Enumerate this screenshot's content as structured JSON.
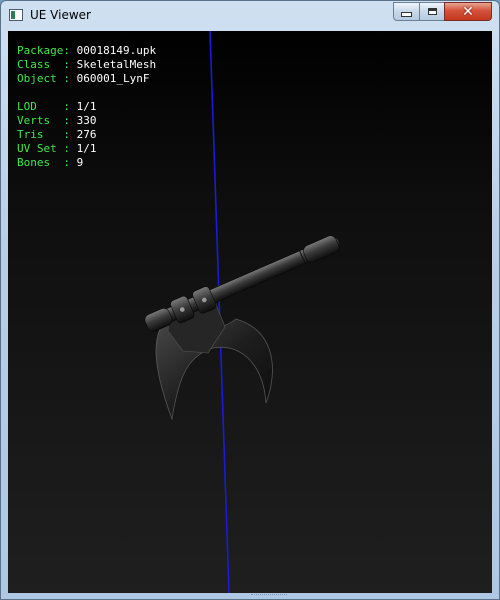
{
  "window": {
    "title": "UE Viewer",
    "icon": "app-window-icon",
    "controls": {
      "minimize": "minimize-icon",
      "maximize": "maximize-icon",
      "close": "✕"
    }
  },
  "info": {
    "package_label": "Package:",
    "package_value": "00018149.upk",
    "class_label": "Class  :",
    "class_value": "SkeletalMesh",
    "object_label": "Object :",
    "object_value": "060001_LynF",
    "lod_label": "LOD    :",
    "lod_value": "1/1",
    "verts_label": "Verts  :",
    "verts_value": "330",
    "tris_label": "Tris   :",
    "tris_value": "276",
    "uvset_label": "UV Set :",
    "uvset_value": "1/1",
    "bones_label": "Bones  :",
    "bones_value": "9"
  },
  "colors": {
    "label_green": "#3ee84a",
    "value_white": "#ffffff",
    "axis_blue": "#1a1ad8",
    "viewport_top": "#000000",
    "viewport_bottom": "#1f1f1f"
  }
}
